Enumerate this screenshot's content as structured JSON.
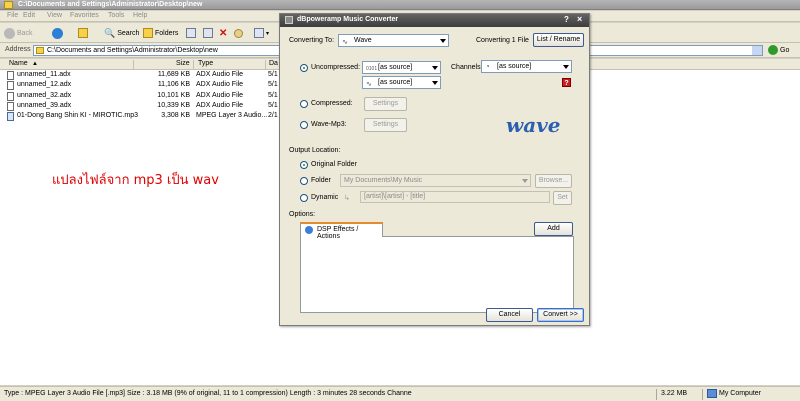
{
  "explorer": {
    "title": "C:\\Documents and Settings\\Administrator\\Desktop\\new",
    "menu": [
      "File",
      "Edit",
      "View",
      "Favorites",
      "Tools",
      "Help"
    ],
    "toolbar": {
      "back": "Back",
      "search": "Search",
      "folders": "Folders"
    },
    "address": {
      "label": "Address",
      "value": "C:\\Documents and Settings\\Administrator\\Desktop\\new",
      "go": "Go"
    },
    "columns": {
      "name": "Name",
      "size": "Size",
      "type": "Type",
      "date": "Da"
    },
    "files": [
      {
        "name": "unnamed_11.adx",
        "size": "11,689 KB",
        "type": "ADX Audio File",
        "date": "5/1"
      },
      {
        "name": "unnamed_12.adx",
        "size": "11,106 KB",
        "type": "ADX Audio File",
        "date": "5/1"
      },
      {
        "name": "unnamed_32.adx",
        "size": "10,101 KB",
        "type": "ADX Audio File",
        "date": "5/1"
      },
      {
        "name": "unnamed_39.adx",
        "size": "10,339 KB",
        "type": "ADX Audio File",
        "date": "5/1"
      },
      {
        "name": "01-Dong Bang Shin KI - MIROTIC.mp3",
        "size": "3,308 KB",
        "type": "MPEG Layer 3 Audio...",
        "date": "2/1"
      }
    ],
    "overlay_text": "แปลงไฟล์จาก mp3 เป็น wav",
    "status": {
      "info": "Type : MPEG Layer 3 Audio File [.mp3] Size : 3.18 MB (9% of original, 11 to 1 compression) Length : 3 minutes 28 seconds Channe",
      "size": "3.22 MB",
      "location": "My Computer"
    }
  },
  "dialog": {
    "title": "dBpoweramp Music Converter",
    "help": "?",
    "close": "×",
    "converting_to_label": "Converting To:",
    "format": "Wave",
    "converting_count": "Converting 1 File",
    "list_rename": "List / Rename",
    "uncompressed": "Uncompressed:",
    "bits_value": "[as source]",
    "rate_value": "[as source]",
    "channels_label": "Channels",
    "channels_value": "[as source]",
    "help_badge": "?",
    "compressed": "Compressed:",
    "wave_mp3": "Wave-Mp3:",
    "settings": "Settings",
    "logo_text": "wave",
    "output_location": "Output Location:",
    "original_folder": "Original Folder",
    "folder": "Folder",
    "folder_value": "My Documents\\My Music",
    "browse": "Browse...",
    "dynamic": "Dynamic",
    "dynamic_value": "[artist]\\[artist] - [title]",
    "set": "Set",
    "options": "Options:",
    "dsp_tab": "DSP Effects / Actions",
    "add": "Add",
    "cancel": "Cancel",
    "convert": "Convert >>"
  }
}
